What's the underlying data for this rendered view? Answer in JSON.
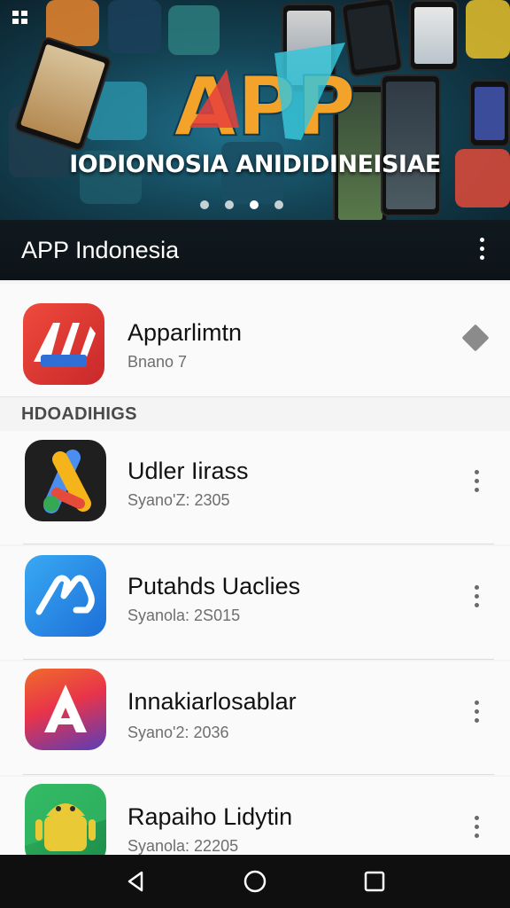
{
  "banner": {
    "title": "IODIONOSIA ANIDIDINEISIAE",
    "logo_text": "APP",
    "dots": [
      false,
      false,
      true,
      false
    ]
  },
  "appbar": {
    "title": "APP Indonesia",
    "menu_icon": "more-vert-icon"
  },
  "featured": {
    "title": "Apparlimtn",
    "subtitle": "Bnano 7",
    "action_icon": "diamond-icon"
  },
  "section": {
    "header": "HDOADIHIGS"
  },
  "apps": [
    {
      "title": "Udler Iirass",
      "subtitle": "Syano'Z: 2305",
      "icon": "google-ads-icon"
    },
    {
      "title": "Putahds Uaclies",
      "subtitle": "Syanola: 2S015",
      "icon": "loop-logo-icon"
    },
    {
      "title": "Innakiarlosablar",
      "subtitle": "Syano'2: 2036",
      "icon": "letter-a-icon"
    },
    {
      "title": "Rapaiho Lidytin",
      "subtitle": "Syanola: 22205",
      "icon": "android-icon"
    }
  ],
  "navbar": {
    "back": "back-icon",
    "home": "home-icon",
    "recents": "recents-icon"
  },
  "colors": {
    "appbar_bg": "#0d1418",
    "list_bg": "#fafafa",
    "navbar_bg": "#0f0f0f"
  }
}
